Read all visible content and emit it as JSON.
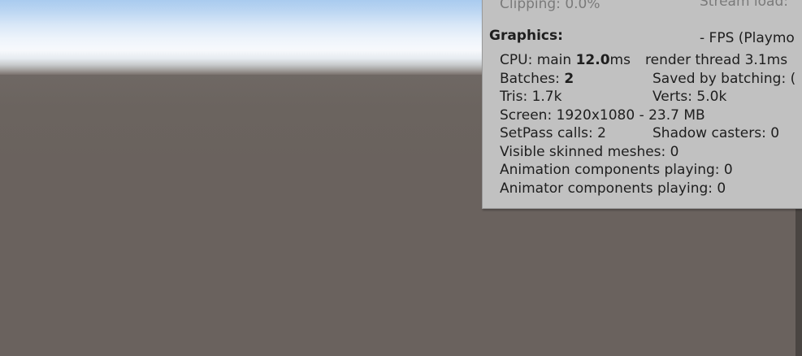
{
  "stats": {
    "top_left": "Clipping: 0.0%",
    "top_right": "Stream load:",
    "graphics_header": "Graphics:",
    "fps_label": "- FPS (Playmo",
    "cpu_prefix": "CPU: main ",
    "cpu_main_value": "12.0",
    "cpu_main_unit": "ms",
    "cpu_render": "render thread 3.1ms",
    "batches_prefix": "Batches: ",
    "batches_value": "2",
    "saved_by_batching": "Saved by batching: (",
    "tris": "Tris: 1.7k",
    "verts": "Verts: 5.0k",
    "screen": "Screen: 1920x1080 - 23.7 MB",
    "setpass": "SetPass calls: 2",
    "shadow_casters": "Shadow casters: 0",
    "visible_skinned": "Visible skinned meshes: 0",
    "animation_components": "Animation components playing: 0",
    "animator_components": "Animator components playing: 0"
  }
}
